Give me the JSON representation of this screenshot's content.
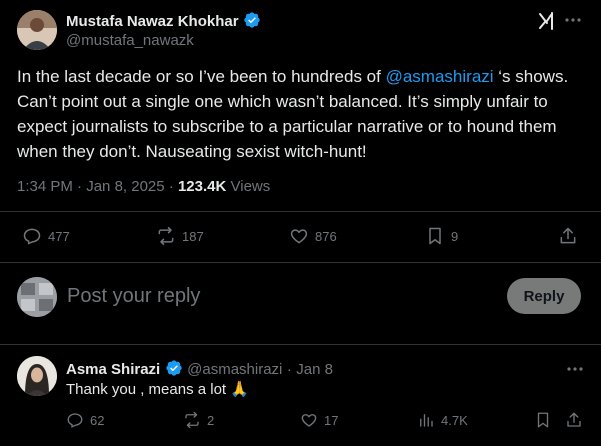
{
  "main_tweet": {
    "author_name": "Mustafa Nawaz Khokhar",
    "author_handle": "@mustafa_nawazk",
    "text_before_mention": "In the last decade or so I’ve been to hundreds of ",
    "mention": "@asmashirazi",
    "text_after_mention": " ‘s shows. Can’t point out a single one which wasn’t balanced. It’s simply unfair to expect journalists to subscribe to a particular narrative or to hound them when they don’t. Nauseating sexist witch-hunt!",
    "time": "1:34 PM",
    "date": "Jan 8, 2025",
    "views_count": "123.4K",
    "views_label": "Views",
    "replies": "477",
    "reposts": "187",
    "likes": "876",
    "bookmarks": "9"
  },
  "reply_box": {
    "placeholder": "Post your reply",
    "button_label": "Reply"
  },
  "reply_tweet": {
    "author_name": "Asma Shirazi",
    "author_handle": "@asmashirazi",
    "date": "Jan 8",
    "text": "Thank you , means a lot 🙏",
    "replies": "62",
    "reposts": "2",
    "likes": "17",
    "views": "4.7K"
  },
  "colors": {
    "background": "#000000",
    "text": "#e7e9ea",
    "muted": "#71767b",
    "accent": "#1d9bf0",
    "divider": "#2f3336"
  }
}
